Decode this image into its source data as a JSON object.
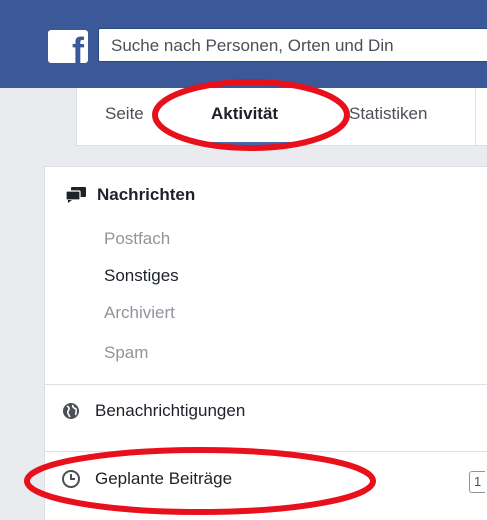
{
  "search": {
    "placeholder": "Suche nach Personen, Orten und Din"
  },
  "tabs": [
    {
      "label": "Seite"
    },
    {
      "label": "Aktivität"
    },
    {
      "label": "Statistiken"
    }
  ],
  "nachrichten": {
    "title": "Nachrichten",
    "items": [
      "Postfach",
      "Sonstiges",
      "Archiviert",
      "Spam"
    ]
  },
  "benachrichtigungen": {
    "label": "Benachrichtigungen"
  },
  "geplante": {
    "label": "Geplante Beiträge",
    "stub_text": "1"
  },
  "colors": {
    "brand": "#3b5998",
    "highlight": "#e8101a",
    "tab_active_underline": "#4267b2"
  }
}
